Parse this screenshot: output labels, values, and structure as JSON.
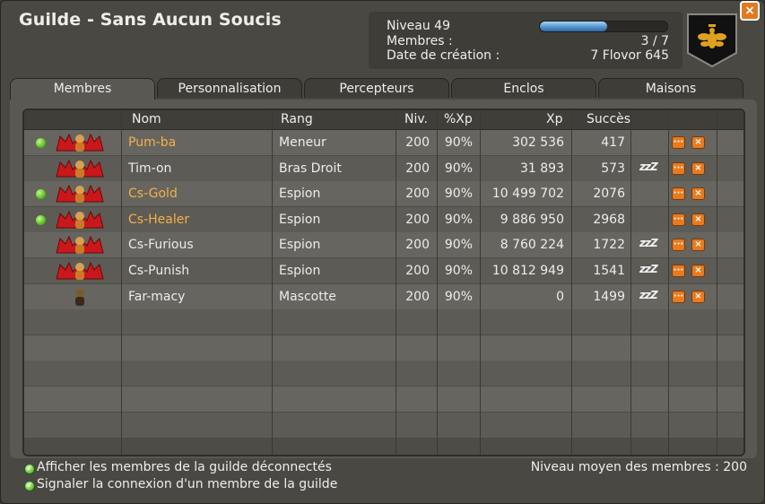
{
  "window": {
    "title": "Guilde - Sans Aucun Soucis",
    "close_label": "×"
  },
  "info": {
    "level_label": "Niveau 49",
    "level_progress_percent": 53,
    "members_label": "Membres :",
    "members_value": "3 / 7",
    "creation_label": "Date de création :",
    "creation_value": "7 Flovor 645"
  },
  "tabs": [
    {
      "label": "Membres"
    },
    {
      "label": "Personnalisation"
    },
    {
      "label": "Percepteurs"
    },
    {
      "label": "Enclos"
    },
    {
      "label": "Maisons"
    }
  ],
  "table": {
    "headers": {
      "nom": "Nom",
      "rang": "Rang",
      "niv": "Niv.",
      "pxp": "%Xp",
      "xp": "Xp",
      "succes": "Succès"
    },
    "rows": [
      {
        "name": "Pum-ba",
        "rank": "Meneur",
        "level": "200",
        "pxp": "90%",
        "xp": "302 536",
        "success": "417",
        "online": true,
        "wings": true
      },
      {
        "name": "Tim-on",
        "rank": "Bras Droit",
        "level": "200",
        "pxp": "90%",
        "xp": "31 893",
        "success": "573",
        "online": false,
        "wings": true
      },
      {
        "name": "Cs-Gold",
        "rank": "Espion",
        "level": "200",
        "pxp": "90%",
        "xp": "10 499 702",
        "success": "2076",
        "online": true,
        "wings": true
      },
      {
        "name": "Cs-Healer",
        "rank": "Espion",
        "level": "200",
        "pxp": "90%",
        "xp": "9 886 950",
        "success": "2968",
        "online": true,
        "wings": true
      },
      {
        "name": "Cs-Furious",
        "rank": "Espion",
        "level": "200",
        "pxp": "90%",
        "xp": "8 760 224",
        "success": "1722",
        "online": false,
        "wings": true
      },
      {
        "name": "Cs-Punish",
        "rank": "Espion",
        "level": "200",
        "pxp": "90%",
        "xp": "10 812 949",
        "success": "1541",
        "online": false,
        "wings": true
      },
      {
        "name": "Far-macy",
        "rank": "Mascotte",
        "level": "200",
        "pxp": "90%",
        "xp": "0",
        "success": "1499",
        "online": false,
        "wings": false
      }
    ],
    "afk_icon": "zzZ",
    "more_button_icon": "···",
    "kick_button_icon": "×"
  },
  "footer": {
    "option1": "Afficher les membres de la guilde déconnectés",
    "option2": "Signaler la connexion d'un membre de la guilde",
    "average": "Niveau moyen des membres : 200"
  },
  "colors": {
    "online_name": "#f2b04a",
    "accent_orange": "#e77b20",
    "xp_bar": "#4e8ec8"
  }
}
